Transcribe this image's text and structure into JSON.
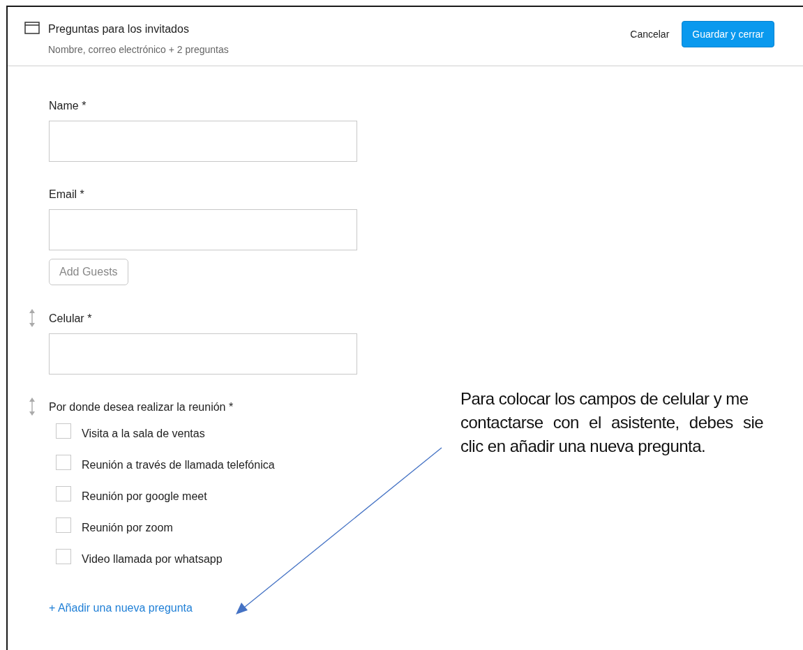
{
  "header": {
    "title": "Preguntas para los invitados",
    "subtitle": "Nombre, correo electrónico + 2 preguntas",
    "cancel": "Cancelar",
    "save": "Guardar y cerrar"
  },
  "questions": [
    {
      "kind": "text",
      "label": "Name *",
      "draggable": false
    },
    {
      "kind": "text",
      "label": "Email *",
      "draggable": false,
      "extra_button": "Add Guests"
    },
    {
      "kind": "text",
      "label": "Celular *",
      "draggable": true
    },
    {
      "kind": "checkboxes",
      "label": "Por donde desea realizar la reunión *",
      "draggable": true,
      "options": [
        {
          "label": "Visita a la sala de ventas",
          "checked": false
        },
        {
          "label": "Reunión a través de llamada telefónica",
          "checked": false
        },
        {
          "label": "Reunión por google meet",
          "checked": false
        },
        {
          "label": "Reunión por zoom",
          "checked": false
        },
        {
          "label": "Video llamada por whatsapp",
          "checked": false
        }
      ]
    }
  ],
  "add_question": "+ Añadir una nueva pregunta",
  "annotation": {
    "lines": [
      "Para colocar los campos de celular y me",
      "contactarse con el asistente, debes sie",
      "clic en añadir una nueva pregunta."
    ]
  }
}
